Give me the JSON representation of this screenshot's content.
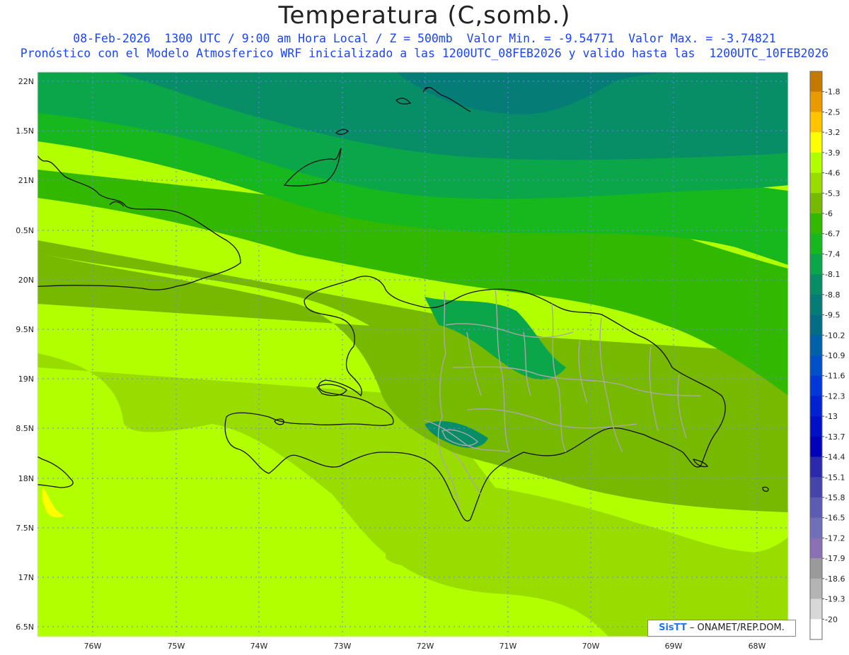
{
  "title": "Temperatura (C,somb.)",
  "subtitle_line1": "08-Feb-2026  1300 UTC / 9:00 am Hora Local / Z = 500mb  Valor Min. = -9.54771  Valor Max. = -3.74821",
  "subtitle_line2": "Pronóstico con el Modelo Atmosferico WRF inicializado a las 1200UTC_08FEB2026 y valido hasta las  1200UTC_10FEB2026",
  "credit": {
    "logo": "SisTT",
    "text": "– ONAMET/REP.DOM."
  },
  "map": {
    "variable": "Temperatura",
    "units": "C",
    "level": "500mb",
    "lat_labels": [
      "22N",
      "1.5N",
      "21N",
      "0.5N",
      "20N",
      "9.5N",
      "19N",
      "8.5N",
      "18N",
      "7.5N",
      "17N",
      "6.5N"
    ],
    "lon_labels": [
      "76W",
      "75W",
      "74W",
      "73W",
      "72W",
      "71W",
      "70W",
      "69W",
      "68W"
    ],
    "min_value": -9.54771,
    "max_value": -3.74821
  },
  "colorbar": {
    "levels": [
      {
        "label": "-1.8",
        "color": "#c47a00"
      },
      {
        "label": "-2.5",
        "color": "#e89a00"
      },
      {
        "label": "-3.2",
        "color": "#ffc400"
      },
      {
        "label": "-3.9",
        "color": "#ffff00"
      },
      {
        "label": "-4.6",
        "color": "#b2ff00"
      },
      {
        "label": "-5.3",
        "color": "#99dd00"
      },
      {
        "label": "-6",
        "color": "#77b800"
      },
      {
        "label": "-6.7",
        "color": "#33b800"
      },
      {
        "label": "-7.4",
        "color": "#16b81e"
      },
      {
        "label": "-8.1",
        "color": "#0ca64a"
      },
      {
        "label": "-8.8",
        "color": "#078e66"
      },
      {
        "label": "-9.5",
        "color": "#067c76"
      },
      {
        "label": "-10.2",
        "color": "#056c86"
      },
      {
        "label": "-10.9",
        "color": "#0060a8"
      },
      {
        "label": "-11.6",
        "color": "#0050c8"
      },
      {
        "label": "-12.3",
        "color": "#0038d8"
      },
      {
        "label": "-13",
        "color": "#0022d0"
      },
      {
        "label": "-13.7",
        "color": "#0010c4"
      },
      {
        "label": "-14.4",
        "color": "#0000b8"
      },
      {
        "label": "-15.1",
        "color": "#2a2aac"
      },
      {
        "label": "-15.8",
        "color": "#4444aa"
      },
      {
        "label": "-16.5",
        "color": "#5c5cb4"
      },
      {
        "label": "-17.2",
        "color": "#7070b8"
      },
      {
        "label": "-17.9",
        "color": "#8a70b4"
      },
      {
        "label": "-18.6",
        "color": "#9a9a9a"
      },
      {
        "label": "-19.3",
        "color": "#b4b4b4"
      },
      {
        "label": "-20",
        "color": "#d8d8d8"
      },
      {
        "label": "",
        "color": "#ffffff"
      }
    ]
  }
}
